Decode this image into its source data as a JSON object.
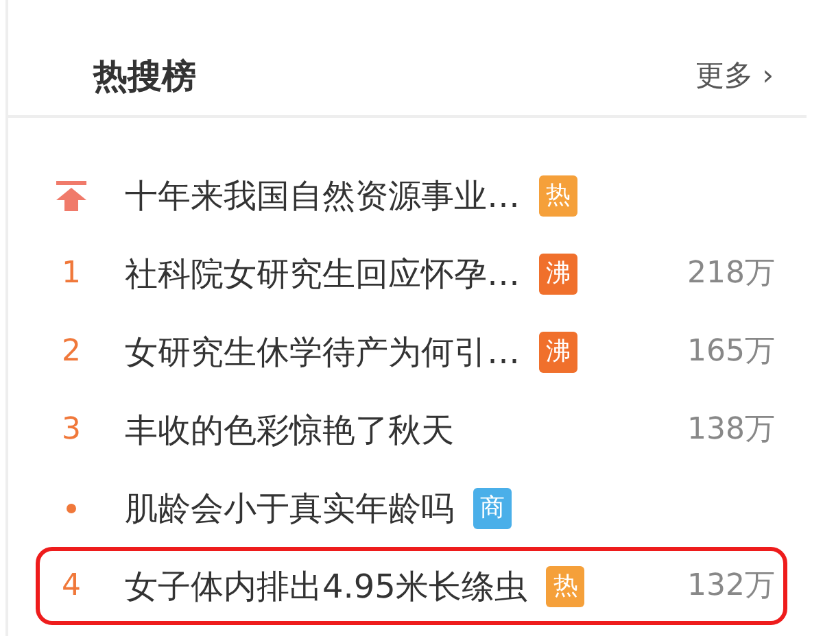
{
  "panel": {
    "title": "热搜榜",
    "more_link": "更多",
    "more_caret": "›"
  },
  "items": [
    {
      "kind": "pinned",
      "title": "十年来我国自然资源事业…",
      "badge": "热",
      "color": "#f5a03a",
      "highlighted": false
    },
    {
      "kind": "ranked",
      "rank": "1",
      "title": "社科院女研究生回应怀孕…",
      "badge": "沸",
      "color": "#f0702c",
      "count": "218万",
      "highlighted": false
    },
    {
      "kind": "ranked",
      "rank": "2",
      "title": "女研究生休学待产为何引…",
      "badge": "沸",
      "color": "#f0702c",
      "count": "165万",
      "highlighted": false
    },
    {
      "kind": "ranked",
      "rank": "3",
      "title": "丰收的色彩惊艳了秋天",
      "count": "138万",
      "highlighted": false
    },
    {
      "kind": "promoted",
      "title": "肌龄会小于真实年龄吗",
      "badge": "商",
      "color": "#4aafe9",
      "highlighted": false
    },
    {
      "kind": "ranked",
      "rank": "4",
      "title": "女子体内排出4.95米长绦虫",
      "badge": "热",
      "color": "#f5a03a",
      "count": "132万",
      "highlighted": true
    }
  ]
}
